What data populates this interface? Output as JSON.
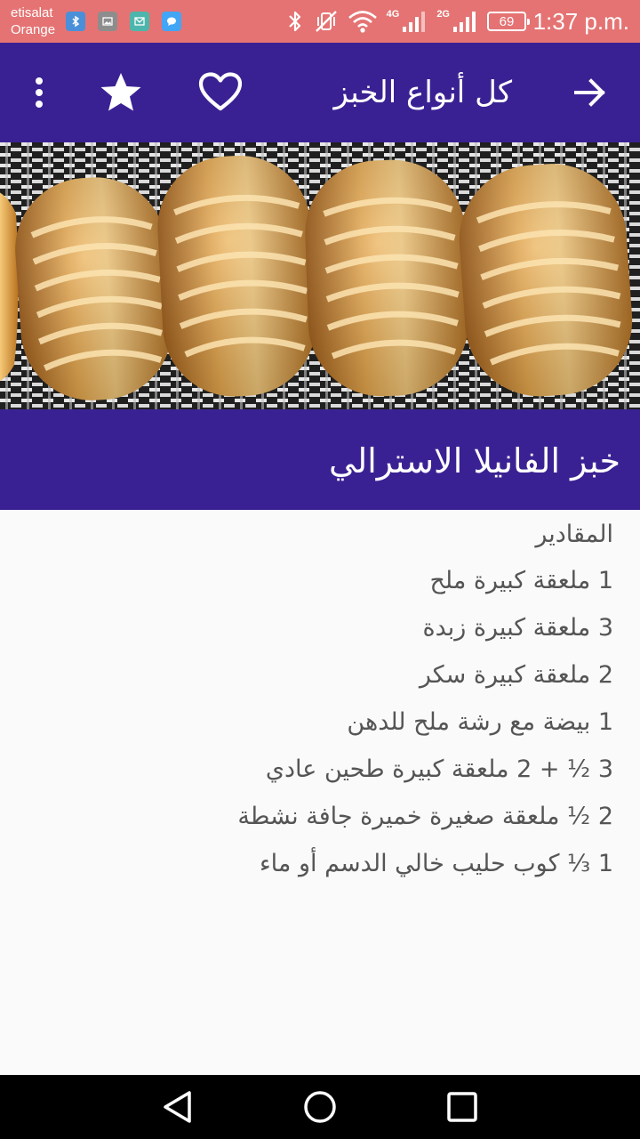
{
  "status_bar": {
    "carrier_line1": "etisalat",
    "carrier_line2": "Orange",
    "network_4g": "4G",
    "network_2g": "2G",
    "battery": "69",
    "time": "1:37 p.m.",
    "notification_icons": [
      "bluetooth-share-icon",
      "gallery-icon",
      "email-icon",
      "messaging-icon"
    ]
  },
  "app_bar": {
    "title": "كل أنواع الخبز",
    "icons": [
      "more-vert-icon",
      "star-icon",
      "heart-outline-icon",
      "arrow-forward-icon"
    ]
  },
  "recipe": {
    "title": "خبز الفانيلا الاسترالي",
    "ingredients_heading": "المقادير",
    "ingredients": [
      "1 ملعقة كبيرة ملح",
      "3 ملعقة كبيرة زبدة",
      "2 ملعقة كبيرة سكر",
      "1 بيضة مع رشة ملح للدهن",
      "3 ½ + 2 ملعقة كبيرة طحين عادي",
      "2 ½ ملعقة صغيرة خميرة جافة نشطة",
      "1 ⅓ كوب حليب خالي الدسم أو ماء"
    ]
  },
  "nav_bar": {
    "icons": [
      "nav-back-icon",
      "nav-home-icon",
      "nav-recents-icon"
    ]
  },
  "colors": {
    "status_bar": "#e57373",
    "app_bar": "#3a2193",
    "text": "#555555",
    "background": "#fafafa"
  }
}
